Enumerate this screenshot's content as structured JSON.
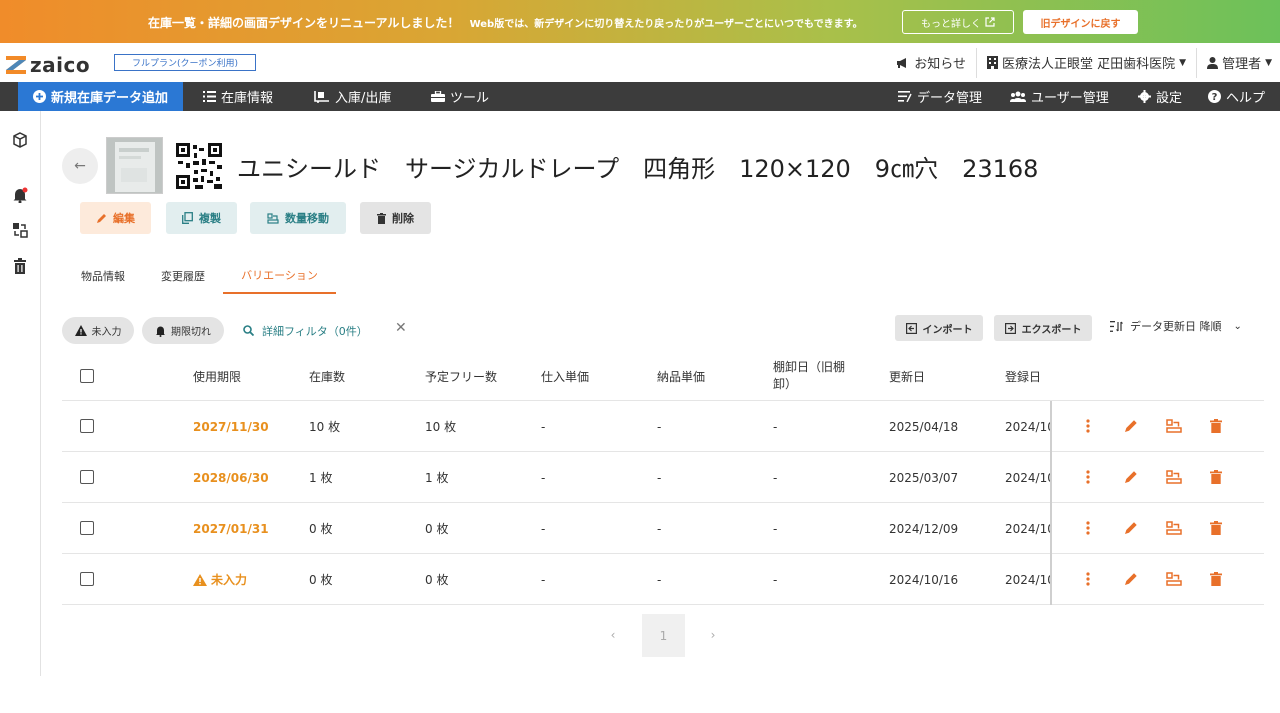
{
  "banner": {
    "message": "在庫一覧・詳細の画面デザインをリニューアルしました！",
    "sub": "Web版では、新デザインに切り替えたり戻ったりがユーザーごとにいつでもできます。",
    "more_label": "もっと詳しく",
    "old_label": "旧デザインに戻す"
  },
  "header": {
    "logo": "zaico",
    "plan": "フルプラン(クーポン利用)",
    "news": "お知らせ",
    "org": "医療法人正眼堂 疋田歯科医院",
    "user": "管理者"
  },
  "nav": {
    "new_item": "新規在庫データ追加",
    "inventory": "在庫情報",
    "inout": "入庫/出庫",
    "tools": "ツール",
    "data_mgmt": "データ管理",
    "user_mgmt": "ユーザー管理",
    "settings": "設定",
    "help": "ヘルプ"
  },
  "item": {
    "title": "ユニシールド　サージカルドレープ　四角形　120×120　9㎝穴　23168"
  },
  "actions": {
    "edit": "編集",
    "copy": "複製",
    "move": "数量移動",
    "delete": "削除"
  },
  "tabs": {
    "info": "物品情報",
    "history": "変更履歴",
    "variation": "バリエーション"
  },
  "filters": {
    "not_entered": "未入力",
    "expired": "期限切れ",
    "detail_filter": "詳細フィルタ（0件）",
    "import": "インポート",
    "export": "エクスポート",
    "sort": "データ更新日 降順"
  },
  "table": {
    "headers": {
      "expiry": "使用期限",
      "stock": "在庫数",
      "free": "予定フリー数",
      "purchase": "仕入単価",
      "delivery": "納品単価",
      "inventory_line1": "棚卸日（旧棚",
      "inventory_line2": "卸）",
      "updated": "更新日",
      "registered": "登録日"
    },
    "rows": [
      {
        "expiry": "2027/11/30",
        "stock": "10 枚",
        "free": "10 枚",
        "purchase": "-",
        "delivery": "-",
        "inventory": "-",
        "updated": "2025/04/18",
        "registered": "2024/10"
      },
      {
        "expiry": "2028/06/30",
        "stock": "1 枚",
        "free": "1 枚",
        "purchase": "-",
        "delivery": "-",
        "inventory": "-",
        "updated": "2025/03/07",
        "registered": "2024/10"
      },
      {
        "expiry": "2027/01/31",
        "stock": "0 枚",
        "free": "0 枚",
        "purchase": "-",
        "delivery": "-",
        "inventory": "-",
        "updated": "2024/12/09",
        "registered": "2024/10"
      },
      {
        "expiry": "未入力",
        "stock": "0 枚",
        "free": "0 枚",
        "purchase": "-",
        "delivery": "-",
        "inventory": "-",
        "updated": "2024/10/16",
        "registered": "2024/10"
      }
    ]
  },
  "pagination": {
    "current": "1"
  },
  "colors": {
    "accent_orange": "#e8901e",
    "nav_bg": "#3c3c3c",
    "new_btn": "#2b78d4",
    "teal": "#2a7f85"
  }
}
